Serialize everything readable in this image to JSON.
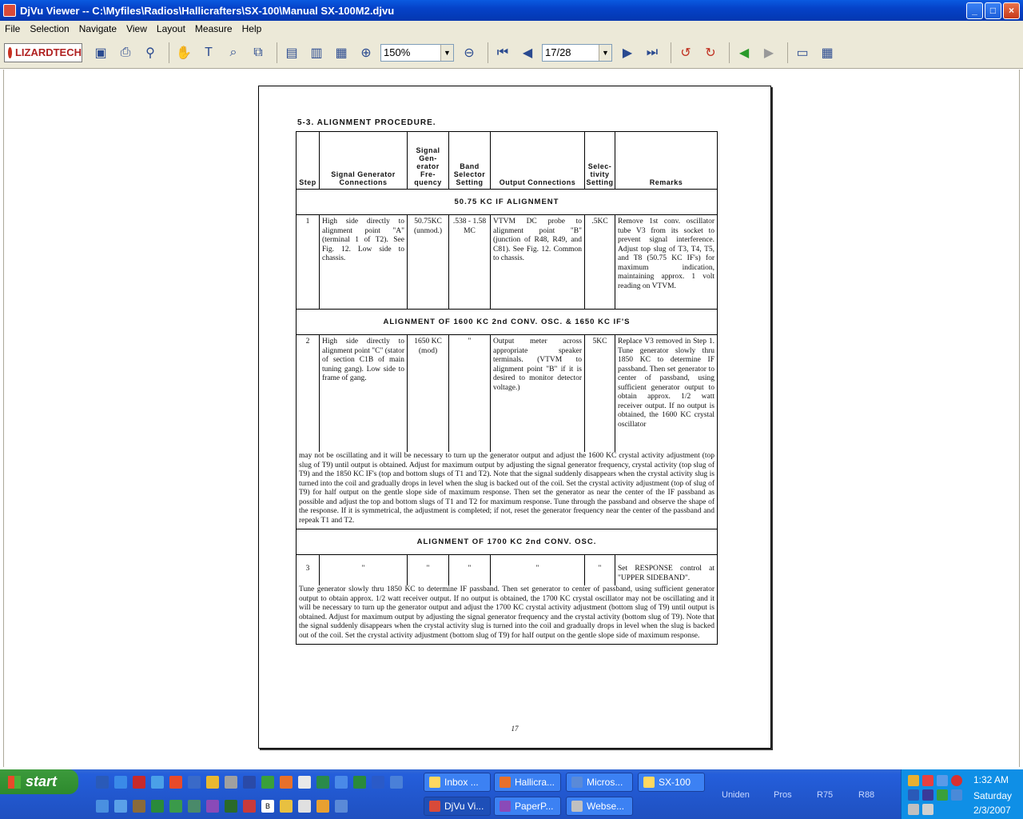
{
  "window": {
    "title": "DjVu Viewer -- C:\\Myfiles\\Radios\\Hallicrafters\\SX-100\\Manual SX-100M2.djvu",
    "minimize": "_",
    "maximize": "□",
    "close": "×"
  },
  "menu": [
    "File",
    "Selection",
    "Navigate",
    "View",
    "Layout",
    "Measure",
    "Help"
  ],
  "toolbar": {
    "logo": "LIZARDTECH",
    "zoom_value": "150%",
    "page_value": "17/28"
  },
  "document": {
    "section_title": "5-3.   ALIGNMENT PROCEDURE.",
    "headers": [
      "Step",
      "Signal Generator Connections",
      "Signal Gen-erator Fre-quency",
      "Band Selector Setting",
      "Output Connections",
      "Selec-tivity Setting",
      "Remarks"
    ],
    "band1": "50.75 KC IF ALIGNMENT",
    "row1": {
      "step": "1",
      "connections": "High side directly to alignment point \"A\" (terminal 1 of T2). See Fig. 12. Low side to chassis.",
      "frequency": "50.75KC (unmod.)",
      "band": ".538 - 1.58 MC",
      "output": "VTVM DC probe to alignment point \"B\" (junction of R48, R49, and C81). See Fig. 12. Common to chassis.",
      "selectivity": ".5KC",
      "remarks": "Remove 1st conv. oscillator tube V3 from its socket to prevent signal interference. Adjust top slug of T3, T4, T5, and T8 (50.75 KC IF's) for maximum indication, maintaining approx. 1 volt reading on VTVM."
    },
    "band2": "ALIGNMENT OF 1600 KC 2nd CONV. OSC. & 1650 KC IF'S",
    "row2": {
      "step": "2",
      "connections": "High side directly to alignment point \"C\" (stator of section C1B of main tuning gang). Low side to frame of gang.",
      "frequency": "1650 KC (mod)",
      "band": "\"",
      "output": "Output meter across appropriate speaker terminals. (VTVM to alignment point \"B\" if it is desired to monitor detector voltage.)",
      "selectivity": "5KC",
      "remarks": "Replace V3 removed in Step 1. Tune generator slowly thru 1850 KC to determine IF passband. Then set generator to center of passband, using sufficient generator output to obtain approx. 1/2 watt receiver output. If no output is obtained, the 1600 KC crystal oscillator",
      "continued": "may not be oscillating and it will be necessary to turn up the generator output and adjust the 1600 KC crystal activity adjustment (top slug of T9) until output is obtained. Adjust for maximum output by adjusting the signal generator frequency, crystal activity (top slug of T9) and the 1850 KC IF's (top and bottom slugs of T1 and T2). Note that the signal suddenly disappears when the crystal activity slug is turned into the coil and gradually drops in level when the slug is backed out of the coil. Set the crystal activity adjustment (top of slug of T9) for half output on the gentle slope side of maximum response. Then set the generator as near the center of the IF passband as possible and adjust the top and bottom slugs of T1 and T2 for maximum response. Tune through the passband and observe the shape of the response. If it is symmetrical, the adjustment is completed; if not, reset the generator frequency near the center of the passband and repeak T1 and T2."
    },
    "band3": "ALIGNMENT OF 1700 KC 2nd CONV. OSC.",
    "row3": {
      "step": "3",
      "ditto": "\"",
      "remarks": "Set RESPONSE control at \"UPPER SIDEBAND\".",
      "continued": "Tune generator slowly thru 1850 KC to determine IF passband. Then set generator to center of passband, using sufficient generator output to obtain approx. 1/2 watt receiver output. If no output is obtained, the 1700 KC crystal oscillator may not be oscillating and it will be necessary to turn up the generator output and adjust the 1700 KC crystal activity adjustment (bottom slug of T9) until output is obtained. Adjust for maximum output by adjusting the signal generator frequency and the crystal activity (bottom slug of T9). Note that the signal suddenly disappears when the crystal activity slug is turned into the coil and gradually drops in level when the slug is backed out of the coil. Set the crystal activity adjustment (bottom slug of T9) for half output on the gentle slope side of maximum response."
    },
    "page_number": "17"
  },
  "taskbar": {
    "start": "start",
    "tasks_top": [
      "Inbox ...",
      "Hallicra...",
      "Micros...",
      "SX-100"
    ],
    "tasks_bottom": [
      "DjVu Vi...",
      "PaperP...",
      "Webse..."
    ],
    "tray_labels": [
      "Uniden",
      "Pros",
      "R75",
      "R88"
    ],
    "time": "1:32 AM",
    "day": "Saturday",
    "date": "2/3/2007"
  }
}
